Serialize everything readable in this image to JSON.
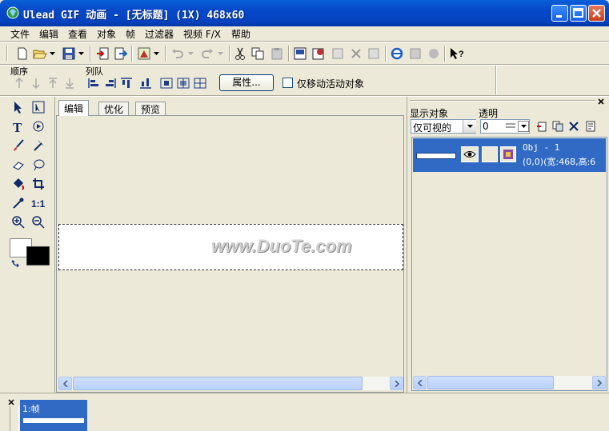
{
  "window": {
    "title": "Ulead GIF 动画 - [无标题] (1X) 468x60"
  },
  "menu": [
    "文件",
    "编辑",
    "查看",
    "对象",
    "帧",
    "过滤器",
    "视频 F/X",
    "帮助"
  ],
  "toolbar2": {
    "order_label": "顺序",
    "queue_label": "列队",
    "properties_button": "属性...",
    "only_move_active_label": "仅移动活动对象"
  },
  "tabs": [
    "编辑",
    "优化",
    "预览"
  ],
  "canvas": {
    "watermark": "www.DuoTe.com"
  },
  "object_panel": {
    "display_label": "显示对象",
    "opacity_label": "透明",
    "display_value": "仅可视的",
    "opacity_value": "0",
    "object": {
      "name": "Obj - 1",
      "info": "(0,0)(宽:468,高:6"
    }
  },
  "frames": [
    {
      "label": "1:帧"
    }
  ],
  "colors": {
    "titlebar": "#0548c8",
    "selected": "#316ac5",
    "face": "#ece9d8"
  }
}
